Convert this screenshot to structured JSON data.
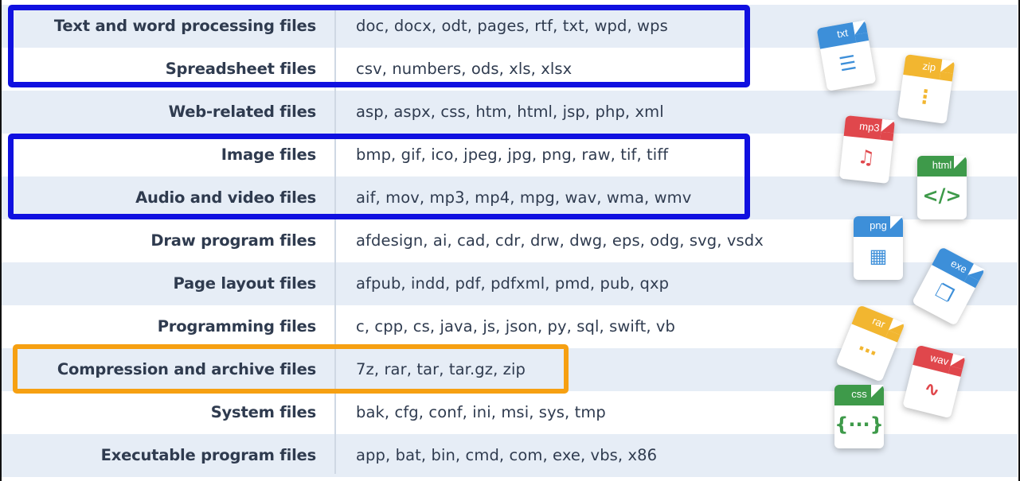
{
  "rows": [
    {
      "category": "Text and word processing files",
      "extensions": "doc, docx, odt, pages, rtf, txt, wpd, wps"
    },
    {
      "category": "Spreadsheet files",
      "extensions": "csv, numbers, ods, xls, xlsx"
    },
    {
      "category": "Web-related files",
      "extensions": "asp, aspx, css, htm, html, jsp, php, xml"
    },
    {
      "category": "Image files",
      "extensions": "bmp, gif, ico, jpeg, jpg, png, raw, tif, tiff"
    },
    {
      "category": "Audio and video files",
      "extensions": "aif, mov, mp3, mp4, mpg, wav, wma, wmv"
    },
    {
      "category": "Draw program files",
      "extensions": "afdesign, ai, cad, cdr, drw, dwg, eps, odg, svg, vsdx"
    },
    {
      "category": "Page layout files",
      "extensions": "afpub, indd, pdf, pdfxml, pmd, pub, qxp"
    },
    {
      "category": "Programming files",
      "extensions": "c, cpp, cs, java, js, json, py, sql, swift, vb"
    },
    {
      "category": "Compression and archive files",
      "extensions": "7z, rar, tar, tar.gz, zip"
    },
    {
      "category": "System files",
      "extensions": "bak, cfg, conf, ini, msi, sys, tmp"
    },
    {
      "category": "Executable program files",
      "extensions": "app, bat, bin, cmd, com, exe, vbs, x86"
    }
  ],
  "icons": [
    {
      "label": "txt",
      "color": "#3d8fd9",
      "glyph": "☰"
    },
    {
      "label": "zip",
      "color": "#f2b630",
      "glyph": "⋮"
    },
    {
      "label": "mp3",
      "color": "#e0474c",
      "glyph": "♫"
    },
    {
      "label": "html",
      "color": "#3e9a4a",
      "glyph": "</>"
    },
    {
      "label": "png",
      "color": "#3d8fd9",
      "glyph": "▦"
    },
    {
      "label": "exe",
      "color": "#3d8fd9",
      "glyph": "❐"
    },
    {
      "label": "rar",
      "color": "#f2b630",
      "glyph": "⋯"
    },
    {
      "label": "wav",
      "color": "#e0474c",
      "glyph": "∿"
    },
    {
      "label": "css",
      "color": "#3e9a4a",
      "glyph": "{···}"
    }
  ],
  "highlight_colors": {
    "blue": "#1010e0",
    "orange": "#f6a012"
  }
}
